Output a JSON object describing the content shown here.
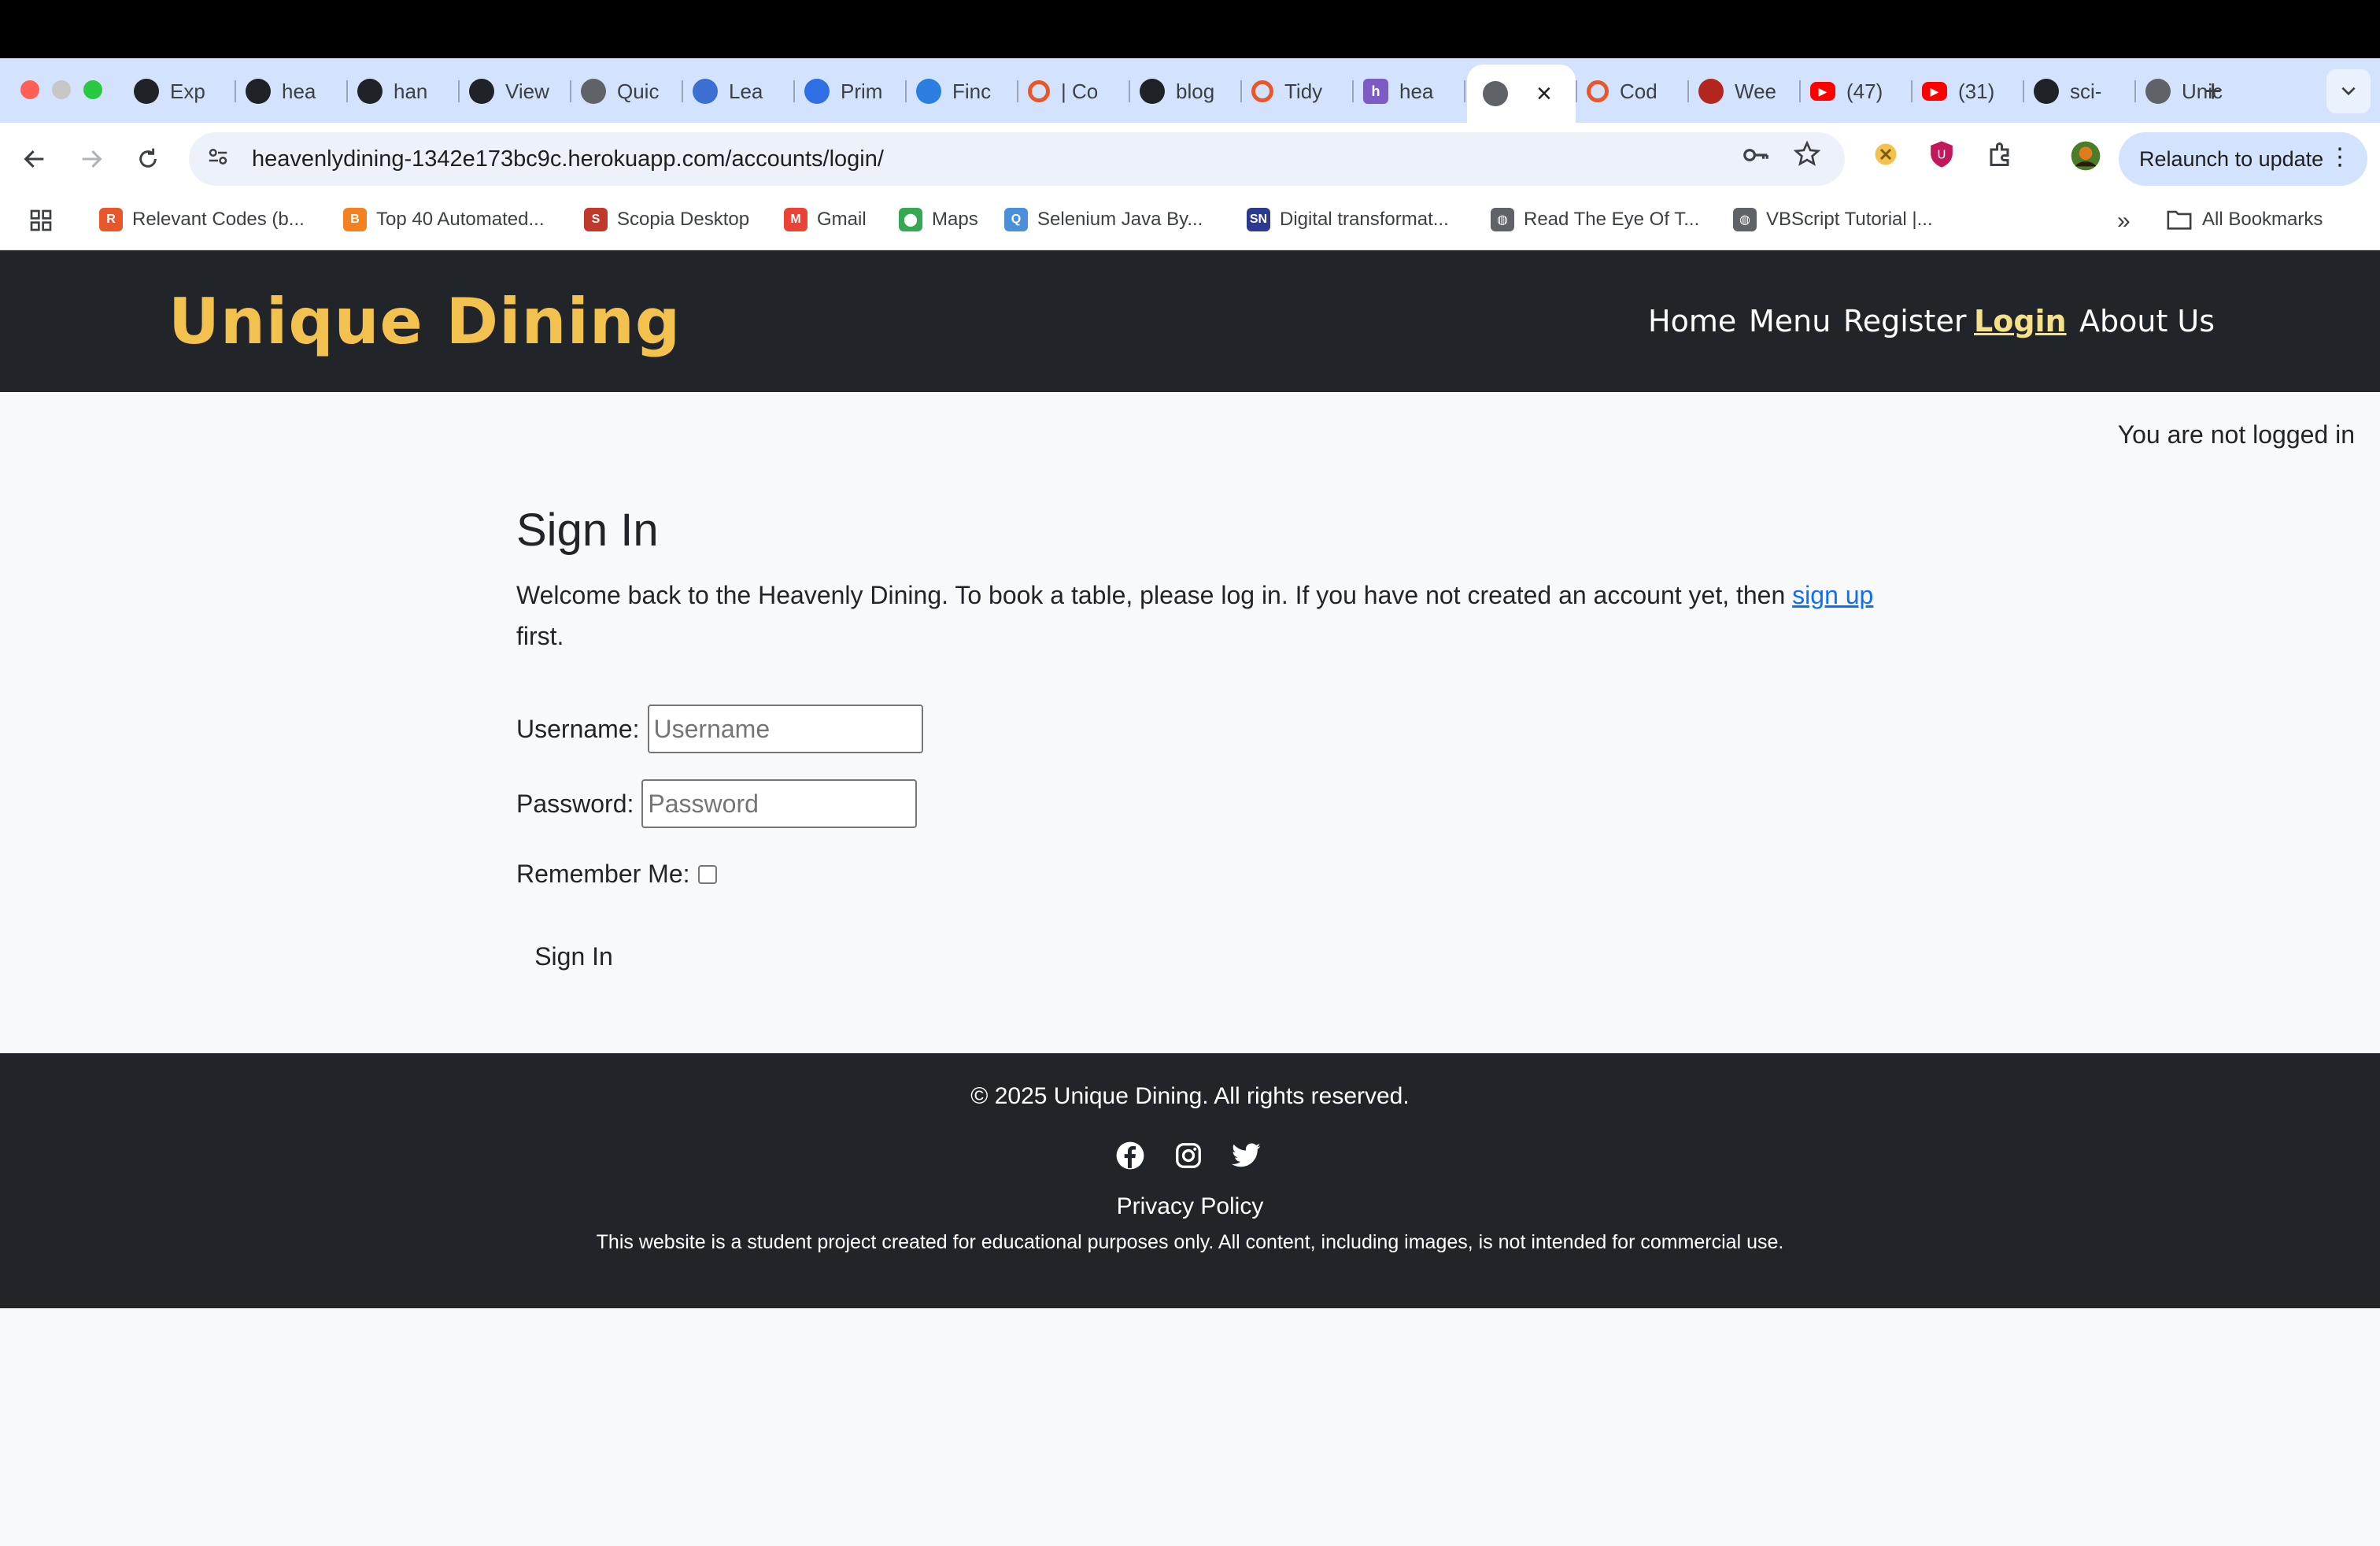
{
  "browser": {
    "tabs": [
      {
        "label": "Exp",
        "icon": "github-icon"
      },
      {
        "label": "hea",
        "icon": "github-icon"
      },
      {
        "label": "han",
        "icon": "github-icon"
      },
      {
        "label": "View",
        "icon": "github-icon"
      },
      {
        "label": "Quic",
        "icon": "quick-icon"
      },
      {
        "label": "Lea",
        "icon": "learn-icon"
      },
      {
        "label": "Prim",
        "icon": "play-icon"
      },
      {
        "label": "Finc",
        "icon": "find-icon"
      },
      {
        "label": "| Co",
        "icon": "circle-icon"
      },
      {
        "label": "blog",
        "icon": "github-icon"
      },
      {
        "label": "Tidy",
        "icon": "circle-icon"
      },
      {
        "label": "hea",
        "icon": "heroku-icon"
      },
      {
        "label": "",
        "icon": "globe-icon"
      },
      {
        "label": "Cod",
        "icon": "circle-icon"
      },
      {
        "label": "Wee",
        "icon": "shield-icon"
      },
      {
        "label": "(47)",
        "icon": "youtube-icon"
      },
      {
        "label": "(31)",
        "icon": "youtube-icon"
      },
      {
        "label": "sci-",
        "icon": "github-icon"
      },
      {
        "label": "Unic",
        "icon": "globe-icon"
      }
    ],
    "active_tab_close": "×",
    "new_tab": "+",
    "url": "heavenlydining-1342e173bc9c.herokuapp.com/accounts/login/",
    "relaunch_label": "Relaunch to update",
    "bookmarks": [
      {
        "label": "Relevant Codes (b...",
        "color": "#e8572a",
        "glyph": "R"
      },
      {
        "label": "Top 40 Automated...",
        "color": "#f4811f",
        "glyph": "B"
      },
      {
        "label": "Scopia Desktop",
        "color": "#c0392b",
        "glyph": "S"
      },
      {
        "label": "Gmail",
        "color": "#ea4335",
        "glyph": "M"
      },
      {
        "label": "Maps",
        "color": "#34a853",
        "glyph": "⬤"
      },
      {
        "label": "Selenium Java By...",
        "color": "#4a90d9",
        "glyph": "Q"
      },
      {
        "label": "Digital transformat...",
        "color": "#2b3a8f",
        "glyph": "SN"
      },
      {
        "label": "Read The Eye Of T...",
        "color": "#5f6368",
        "glyph": "◍"
      },
      {
        "label": "VBScript Tutorial |...",
        "color": "#5f6368",
        "glyph": "◍"
      }
    ],
    "all_bookmarks": "All Bookmarks",
    "overflow": "»"
  },
  "site": {
    "brand": "Unique Dining",
    "nav": [
      "Home",
      "Menu",
      "Register",
      "Login",
      "About Us"
    ],
    "status": "You are not logged in"
  },
  "login": {
    "title": "Sign In",
    "welcome_text": "Welcome back to the Heavenly Dining. To book a table, please log in. If you have not created an account yet, then ",
    "signup_link": "sign up",
    "welcome_tail": "first.",
    "username_label": "Username:",
    "username_placeholder": "Username",
    "password_label": "Password:",
    "password_placeholder": "Password",
    "remember_label": "Remember Me:",
    "submit_label": "Sign In"
  },
  "footer": {
    "copyright": "© 2025 Unique Dining. All rights reserved.",
    "socials": [
      "facebook-icon",
      "instagram-icon",
      "twitter-icon"
    ],
    "privacy": "Privacy Policy",
    "disclaimer": "This website is a student project created for educational purposes only. All content, including images, is not intended for commercial use."
  },
  "colors": {
    "brand": "#f2c14e",
    "header_bg": "#212529",
    "link": "#0d6efd",
    "active_nav": "#f6e08a"
  }
}
